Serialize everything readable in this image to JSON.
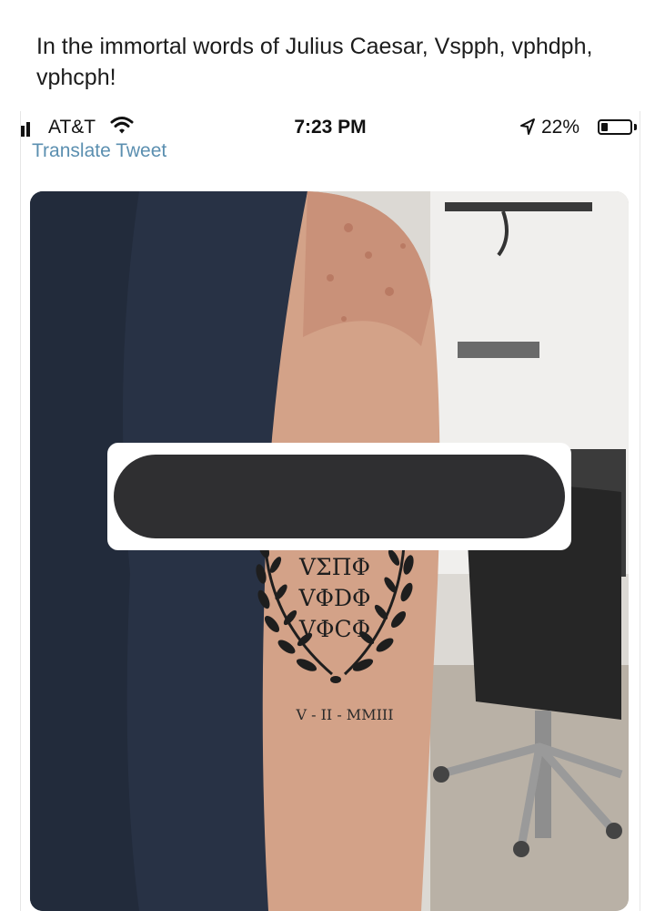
{
  "post": {
    "caption": "In the immortal words of Julius Caesar, Vspph, vphdph, vphcph!"
  },
  "status_bar": {
    "carrier": "AT&T",
    "time": "7:23 PM",
    "battery_percent": "22%",
    "battery_level": 0.22,
    "icons": [
      "signal-icon",
      "wifi-icon",
      "location-arrow-icon",
      "battery-icon"
    ]
  },
  "tweet": {
    "translate_label": "Translate Tweet"
  },
  "tattoo": {
    "line1": "VΣΠΦ",
    "line2": "VΦDΦ",
    "line3": "VΦCΦ",
    "date": "V - II - MMIII"
  },
  "colors": {
    "link": "#5b8fb0",
    "redaction": "#2f2f31"
  }
}
